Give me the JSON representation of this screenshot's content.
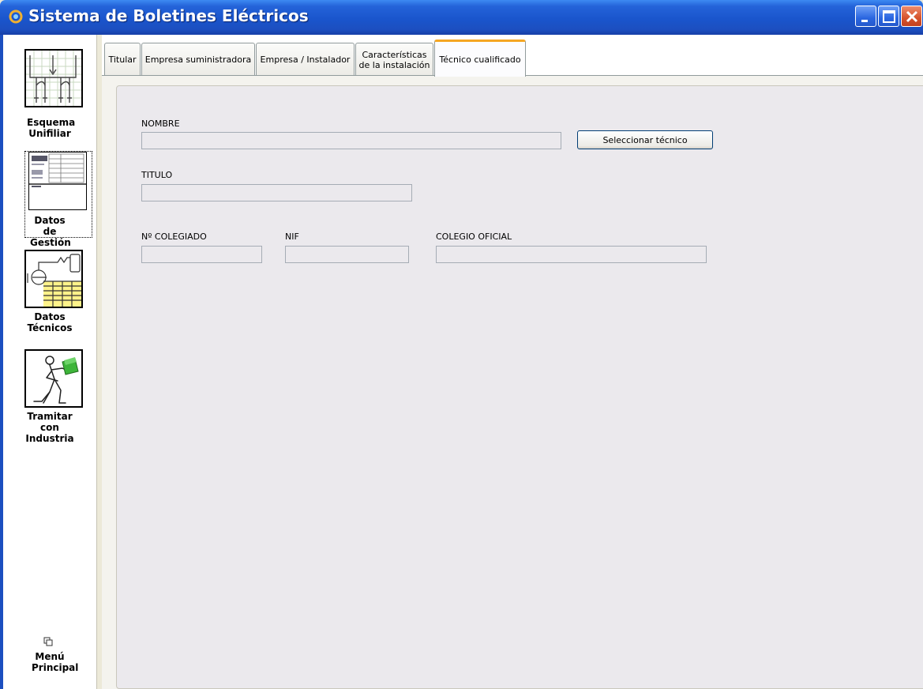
{
  "window": {
    "title": "Sistema de Boletines Eléctricos",
    "colors": {
      "titlebar": "#1c4fc0",
      "tab_highlight": "#f5a623",
      "panel_bg": "#ebe9ed"
    }
  },
  "sidebar": {
    "items": [
      {
        "label": "Esquema Unifiliar",
        "icon": "schematic-icon"
      },
      {
        "label": "Datos de Gestión",
        "icon": "document-icon"
      },
      {
        "label": "Datos Técnicos",
        "icon": "technical-data-icon"
      },
      {
        "label": "Tramitar con Industria",
        "icon": "person-carrying-folder-icon"
      }
    ],
    "menu": {
      "label": "Menú Principal",
      "icon": "window-icon"
    }
  },
  "tabs": [
    {
      "label": "Titular",
      "active": false
    },
    {
      "label": "Empresa suministradora",
      "active": false
    },
    {
      "label": "Empresa / Instalador",
      "active": false
    },
    {
      "label_line1": "Características",
      "label_line2": "de la instalación",
      "active": false
    },
    {
      "label": "Técnico cualificado",
      "active": true
    }
  ],
  "form": {
    "nombre_label": "NOMBRE",
    "nombre_value": "",
    "select_button": "Seleccionar técnico",
    "titulo_label": "TITULO",
    "titulo_value": "",
    "colegiado_label": "Nº COLEGIADO",
    "colegiado_value": "",
    "nif_label": "NIF",
    "nif_value": "",
    "colegio_label": "COLEGIO OFICIAL",
    "colegio_value": ""
  }
}
